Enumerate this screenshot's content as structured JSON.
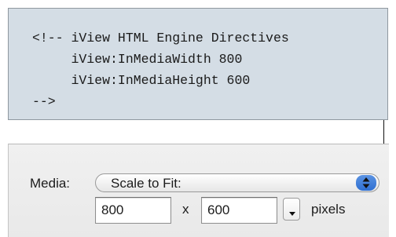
{
  "code": {
    "lines": [
      "<!-- iView HTML Engine Directives",
      "     iView:InMediaWidth 800",
      "     iView:InMediaHeight 600",
      "-->"
    ]
  },
  "media": {
    "label": "Media:",
    "selected": "Scale to Fit:"
  },
  "size": {
    "width": "800",
    "times": "x",
    "height": "600",
    "unit": "pixels"
  },
  "icons": {
    "popup_arrows": "up-down-arrows-icon",
    "stepper": "chevron-down-icon"
  },
  "colors": {
    "code_bg": "#d4dde5",
    "popup_accent": "#2f6fd1"
  }
}
